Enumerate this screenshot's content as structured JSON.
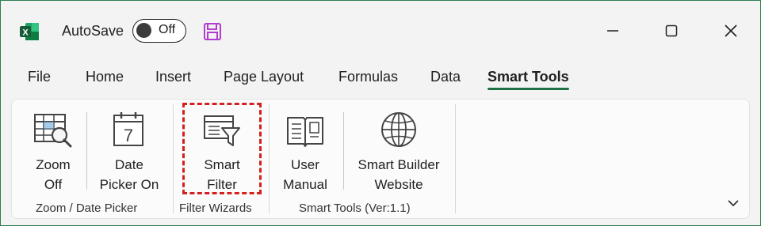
{
  "titlebar": {
    "autosave_label": "AutoSave",
    "autosave_state": "Off",
    "icons": [
      "excel-logo-icon",
      "save-icon",
      "minimize-icon",
      "maximize-icon",
      "close-icon"
    ]
  },
  "tabs": [
    {
      "label": "File",
      "active": false
    },
    {
      "label": "Home",
      "active": false
    },
    {
      "label": "Insert",
      "active": false
    },
    {
      "label": "Page Layout",
      "active": false
    },
    {
      "label": "Formulas",
      "active": false
    },
    {
      "label": "Data",
      "active": false
    },
    {
      "label": "Smart Tools",
      "active": true
    }
  ],
  "ribbon": {
    "buttons": [
      {
        "label": "Zoom\nOff",
        "icon": "zoom-table-icon"
      },
      {
        "label": "Date\nPicker On",
        "icon": "calendar-icon",
        "calendar_day": "7"
      },
      {
        "label": "Smart\nFilter",
        "icon": "filter-table-icon"
      },
      {
        "label": "User\nManual",
        "icon": "book-icon"
      },
      {
        "label": "Smart Builder\nWebsite",
        "icon": "globe-icon"
      }
    ],
    "groups": [
      {
        "label": "Zoom / Date Picker"
      },
      {
        "label": "Filter Wizards"
      },
      {
        "label": "Smart Tools (Ver:1.1)"
      }
    ]
  },
  "colors": {
    "accent": "#1e7145",
    "highlight": "#d41f1f",
    "save_icon": "#b23ccf"
  }
}
